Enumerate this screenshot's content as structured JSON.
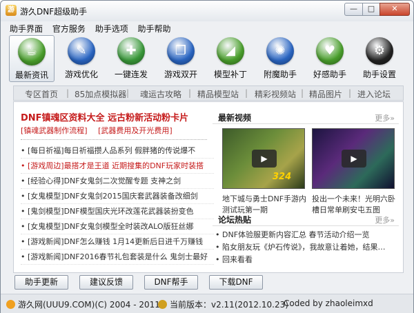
{
  "window": {
    "title": "游久DNF超级助手",
    "min": "—",
    "max": "□",
    "close": "✕"
  },
  "menu": [
    "助手界面",
    "官方服务",
    "助手选项",
    "助手帮助"
  ],
  "toolbar": [
    {
      "label": "最新资讯",
      "icon": "news-cup-icon",
      "color": "#4aa02c",
      "glyph": "☕"
    },
    {
      "label": "游戏优化",
      "icon": "scroll-icon",
      "color": "#2a66c4",
      "glyph": "✎"
    },
    {
      "label": "一键连发",
      "icon": "gamepad-icon",
      "color": "#3a9a3a",
      "glyph": "✚"
    },
    {
      "label": "游戏双开",
      "icon": "dual-window-icon",
      "color": "#2a66c4",
      "glyph": "❐"
    },
    {
      "label": "模型补丁",
      "icon": "ruler-triangle-icon",
      "color": "#4aa02c",
      "glyph": "◢"
    },
    {
      "label": "附魔助手",
      "icon": "globe-icon",
      "color": "#2a66c4",
      "glyph": "✺"
    },
    {
      "label": "好感助手",
      "icon": "heart-ruler-icon",
      "color": "#4aa02c",
      "glyph": "♥"
    },
    {
      "label": "助手设置",
      "icon": "gear-icon",
      "color": "#222222",
      "glyph": "⚙"
    }
  ],
  "nav": [
    "专区首页",
    "85加点模拟器",
    "魂运古攻略",
    "精品模型站",
    "精彩视频站",
    "精品图片",
    "进入论坛"
  ],
  "headline": "DNF镇魂区资料大全  远古粉新活动粉卡片",
  "sublinks": [
    "[镇魂武器制作流程]",
    "[武器费用及开光费用]"
  ],
  "news": [
    {
      "text": "[每日祈福]每日祈福攒人品系列  假胖猪的传说爆不",
      "red": false
    },
    {
      "text": "[游戏周边]最搭才是王道  近期搜集的DNF玩家时装搭",
      "red": true
    },
    {
      "text": "[经验心得]DNF女鬼剑二次觉醒专题  支神之剑",
      "red": false
    },
    {
      "text": "[女鬼模型]DNF女鬼剑2015国庆套武器装备改细剑",
      "red": false
    },
    {
      "text": "[鬼剑模型]DNF模型国庆光环改莲花武器装扮变色",
      "red": false
    },
    {
      "text": "[女鬼模型]DNF女鬼剑模型全时装改ALO版狂丝娜",
      "red": false
    },
    {
      "text": "[游戏新闻]DNF怎么赚钱  1月14更新后日进千万赚钱",
      "red": false
    },
    {
      "text": "[游戏新闻]DNF2016春节礼包套装是什么  鬼剑士最好",
      "red": false
    }
  ],
  "videos": {
    "title": "最新视频",
    "more": "更多»",
    "items": [
      {
        "caption": "地下城与勇士DNF手游内测试玩第一期",
        "badge": "324"
      },
      {
        "caption": "投出一个未来！光明六卧槽日常单刷安屯五图",
        "badge": ""
      }
    ]
  },
  "forum": {
    "title": "论坛热贴",
    "more": "更多»",
    "items": [
      "DNF体验服更新内容汇总  春节活动介绍一览",
      "陷女朋友玩《炉石传说》，我故意让着她，结果…",
      "回来看看"
    ]
  },
  "buttons": [
    "助手更新",
    "建议反馈",
    "DNF帮手",
    "下载DNF"
  ],
  "status": {
    "site": "游久网(UUU9.COM)(C) 2004 - 2011",
    "version": "当前版本：v2.11(2012.10.23)",
    "coder": "Coded by zhaoleimxd"
  }
}
